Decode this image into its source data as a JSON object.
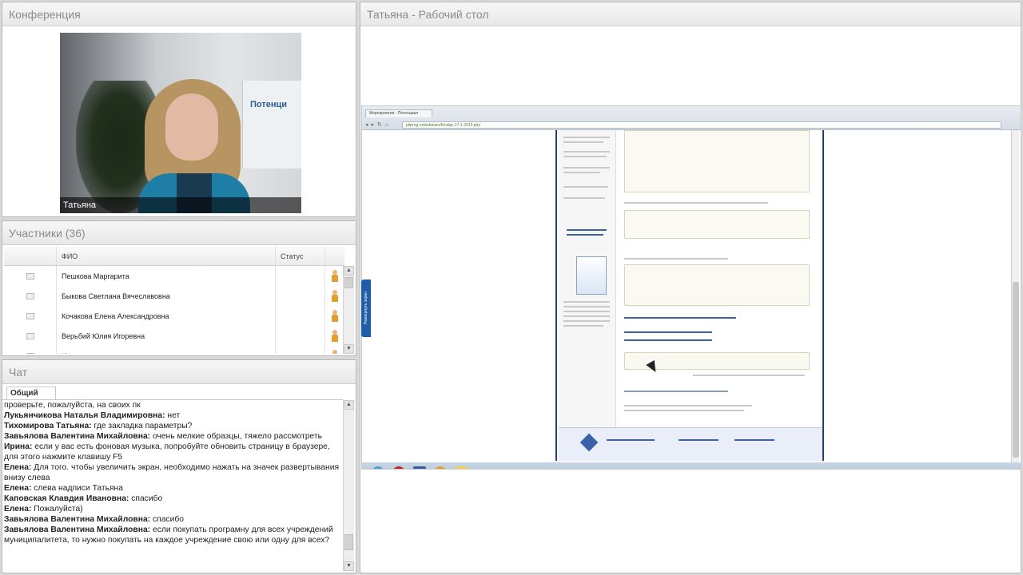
{
  "conference": {
    "title": "Конференция",
    "video_caption": "Татьяна",
    "logo_text": "Потенци"
  },
  "participants": {
    "title": "Участники (36)",
    "columns": [
      "",
      "ФИО",
      "Статус",
      ""
    ],
    "rows": [
      {
        "name": "Пешкова  Маргарита"
      },
      {
        "name": "Быкова  Светлана  Вячеславовна"
      },
      {
        "name": "Кочакова  Елена  Александровна"
      },
      {
        "name": "Верьбий  Юлия  Игоревна"
      },
      {
        "name": "И"
      }
    ]
  },
  "chat": {
    "title": "Чат",
    "tab": "Общий",
    "messages": [
      {
        "author": "",
        "text": "проверьте, пожалуйста, на своих пк"
      },
      {
        "author": "Лукьянчикова Наталья Владимировна:",
        "text": " нет"
      },
      {
        "author": "Тихомирова Татьяна:",
        "text": " где закладка параметры?"
      },
      {
        "author": "Завьялова Валентина Михайловна:",
        "text": " очень мелкие образцы, тяжело рассмотреть"
      },
      {
        "author": "Ирина:",
        "text": " если у вас есть фоновая музыка, попробуйте обновить страницу в браузере, для этого нажмите клавишу F5"
      },
      {
        "author": "Елена:",
        "text": " Для того. чтобы увеличить экран, необходимо нажать на значек развертывания внизу слева"
      },
      {
        "author": "Елена:",
        "text": " слева надписи Татьяна"
      },
      {
        "author": "Каповская Клавдия Ивановна:",
        "text": " спасибо"
      },
      {
        "author": "Елена:",
        "text": " Пожалуйста)"
      },
      {
        "author": "Завьялова Валентина Михайловна:",
        "text": " спасибо"
      },
      {
        "author": "Завьялова Валентина Михайловна:",
        "text": " если покупать програмну для всех учреждений муниципалитета, то нужно покупать на каждое учреждение свою или одну для всех?"
      }
    ]
  },
  "desktop": {
    "title": "Татьяна - Рабочий стол",
    "side_tab": "Развернуть экран",
    "browser_tab": "Мероприятия - Потенциал",
    "url": "pitprog.ru/webinars/fondsp-17-1-2013.php"
  },
  "colors": {
    "panel_header_text": "#8a8a8a",
    "site_border": "#1e3d82",
    "side_tab": "#1e5ea8"
  }
}
